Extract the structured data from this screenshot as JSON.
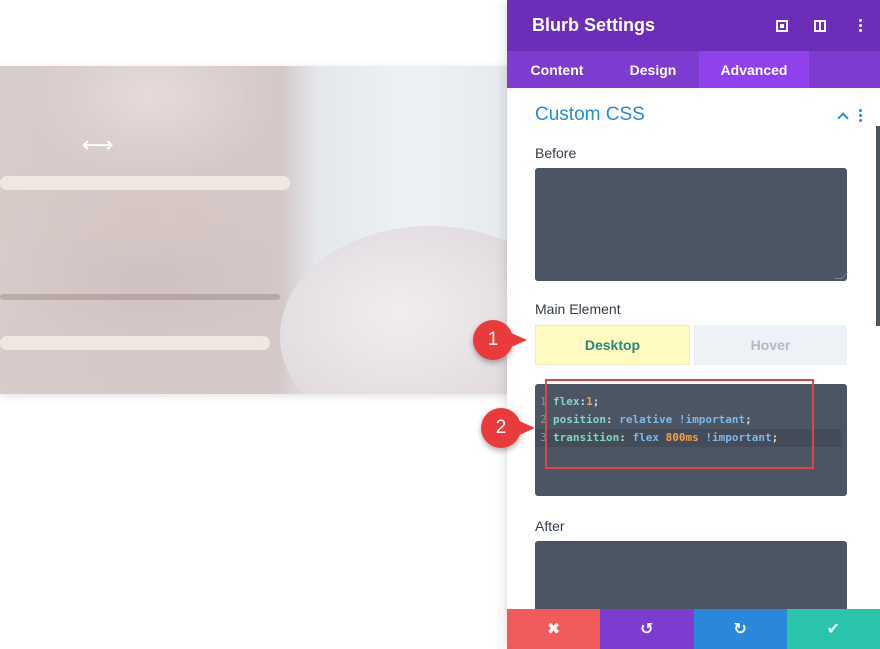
{
  "canvas": {
    "resize_indicator": "⟷"
  },
  "panel": {
    "title": "Blurb Settings",
    "header_icons": [
      "expand-icon",
      "split-view-icon",
      "more-options-icon"
    ],
    "tabs": [
      {
        "label": "Content",
        "active": false
      },
      {
        "label": "Design",
        "active": false
      },
      {
        "label": "Advanced",
        "active": true
      }
    ],
    "section": {
      "title": "Custom CSS",
      "expanded": true
    },
    "fields": {
      "before": {
        "label": "Before",
        "value": ""
      },
      "main_element": {
        "label": "Main Element",
        "modes": [
          {
            "label": "Desktop",
            "active": true
          },
          {
            "label": "Hover",
            "active": false
          }
        ],
        "code_lines": [
          {
            "number": "1",
            "tokens": [
              {
                "t": "flex",
                "c": "prop"
              },
              {
                "t": ":",
                "c": "punc"
              },
              {
                "t": "1",
                "c": "num"
              },
              {
                "t": ";",
                "c": "punc"
              }
            ]
          },
          {
            "number": "2",
            "tokens": [
              {
                "t": "position",
                "c": "prop"
              },
              {
                "t": ": ",
                "c": "punc"
              },
              {
                "t": "relative !important",
                "c": "val"
              },
              {
                "t": ";",
                "c": "punc"
              }
            ]
          },
          {
            "number": "3",
            "tokens": [
              {
                "t": "transition",
                "c": "prop"
              },
              {
                "t": ": ",
                "c": "punc"
              },
              {
                "t": "flex ",
                "c": "val"
              },
              {
                "t": "800ms",
                "c": "num"
              },
              {
                "t": " !important",
                "c": "val"
              },
              {
                "t": ";",
                "c": "punc"
              }
            ]
          }
        ]
      },
      "after": {
        "label": "After",
        "value": ""
      }
    },
    "footer": {
      "cancel_icon": "✖",
      "undo_icon": "↺",
      "redo_icon": "↻",
      "save_icon": "✔"
    }
  },
  "callouts": [
    {
      "label": "1"
    },
    {
      "label": "2"
    }
  ],
  "colors": {
    "header": "#6c2eb9",
    "tabs": "#7d3bcf",
    "active_tab": "#8f42ec",
    "section_title": "#2b87da",
    "code_bg": "#4b5563",
    "cancel": "#f05a5a",
    "undo": "#7d3bcf",
    "redo": "#2b87da",
    "save": "#29c4a9",
    "callout": "#e93b3b"
  }
}
